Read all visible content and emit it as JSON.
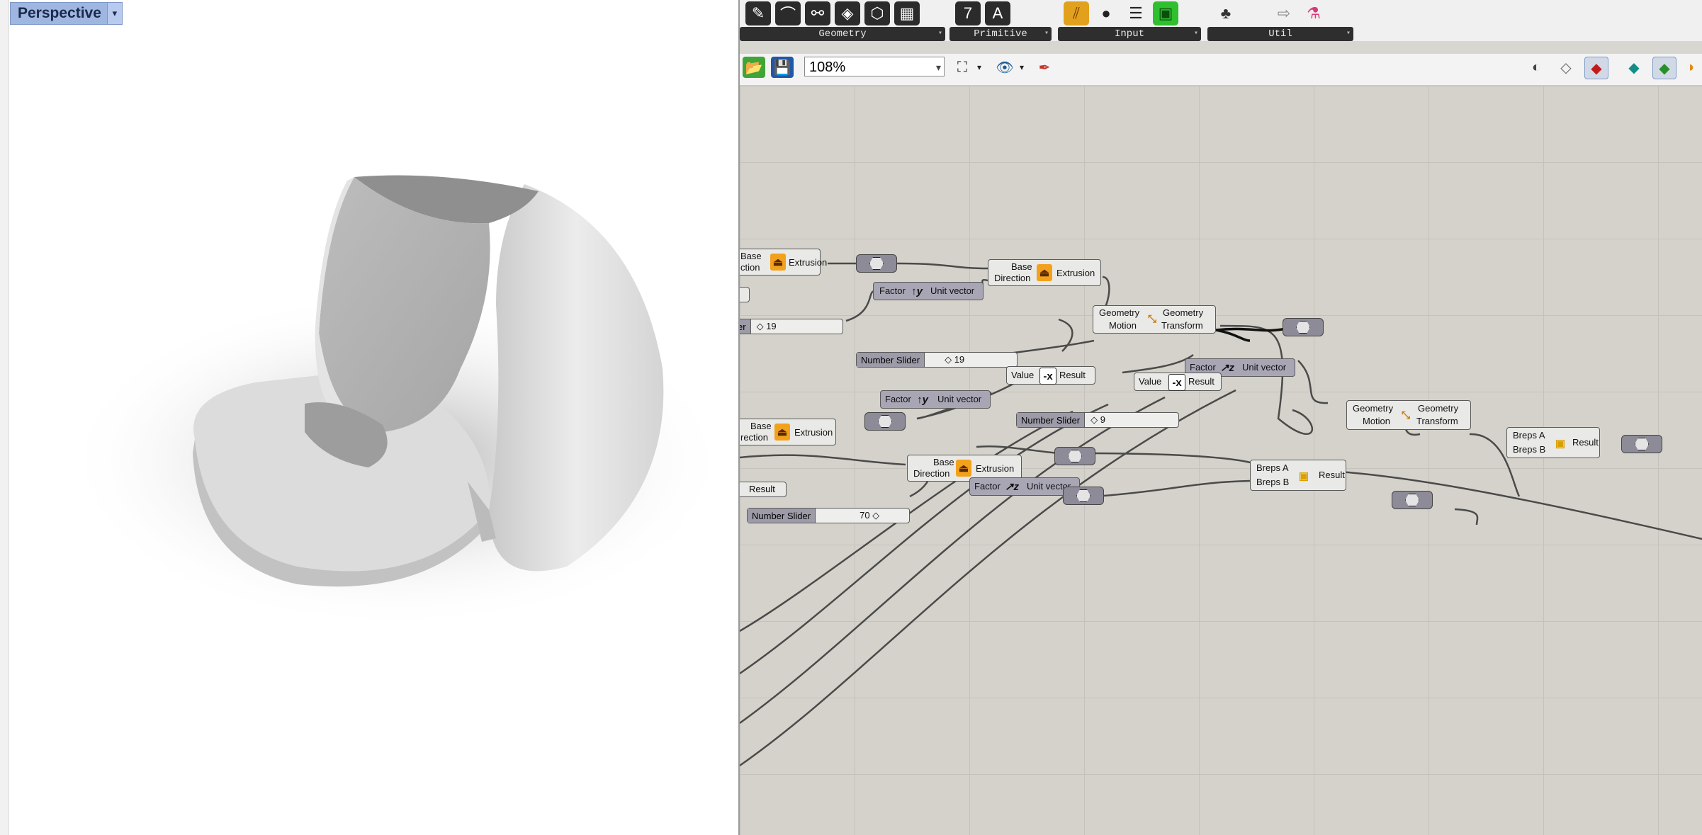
{
  "viewport": {
    "title": "Perspective",
    "dropdown_icon": "chevron-down-icon"
  },
  "tab_groups": [
    {
      "label": "Geometry"
    },
    {
      "label": "Primitive"
    },
    {
      "label": "Input"
    },
    {
      "label": "Util"
    }
  ],
  "canvas_toolbar": {
    "zoom": "108%"
  },
  "nodes": {
    "extrusion1": {
      "in1": "Base",
      "in2": "ction",
      "name": "Extrusion"
    },
    "extrusion2": {
      "in1": "Base",
      "in2": "Direction",
      "name": "Extrusion"
    },
    "extrusion3": {
      "in1": "Base",
      "in2": "rection",
      "name": "Extrusion"
    },
    "extrusion4": {
      "in1": "Base",
      "in2": "Direction",
      "name": "Extrusion"
    },
    "unitY1": {
      "in": "Factor",
      "name": "Unit vector",
      "glyph": "y"
    },
    "unitY2": {
      "in": "Factor",
      "name": "Unit vector",
      "glyph": "y"
    },
    "unitZ1": {
      "in": "Factor",
      "name": "Unit vector",
      "glyph": "z"
    },
    "unitZ2": {
      "in": "Factor",
      "name": "Unit vector",
      "glyph": "z"
    },
    "move1": {
      "in1": "Geometry",
      "in2": "Motion",
      "out1": "Geometry",
      "out2": "Transform"
    },
    "move2": {
      "in1": "Geometry",
      "in2": "Motion",
      "out1": "Geometry",
      "out2": "Transform"
    },
    "neg1": {
      "in": "Value",
      "out": "Result"
    },
    "neg2": {
      "in": "Value",
      "out": "Result"
    },
    "diff1": {
      "in1": "Breps A",
      "in2": "Breps B",
      "out": "Result"
    },
    "diff2": {
      "in1": "Breps A",
      "in2": "Breps B",
      "out": "Result"
    },
    "result_tag": "Result",
    "slider_left_partial": {
      "name": "er",
      "value": "◇ 19"
    },
    "slider1": {
      "name": "Number Slider",
      "value": "◇ 19"
    },
    "slider2": {
      "name": "Number Slider",
      "value": "◇ 9"
    },
    "slider3": {
      "name": "Number Slider",
      "value": "70 ◇"
    }
  }
}
